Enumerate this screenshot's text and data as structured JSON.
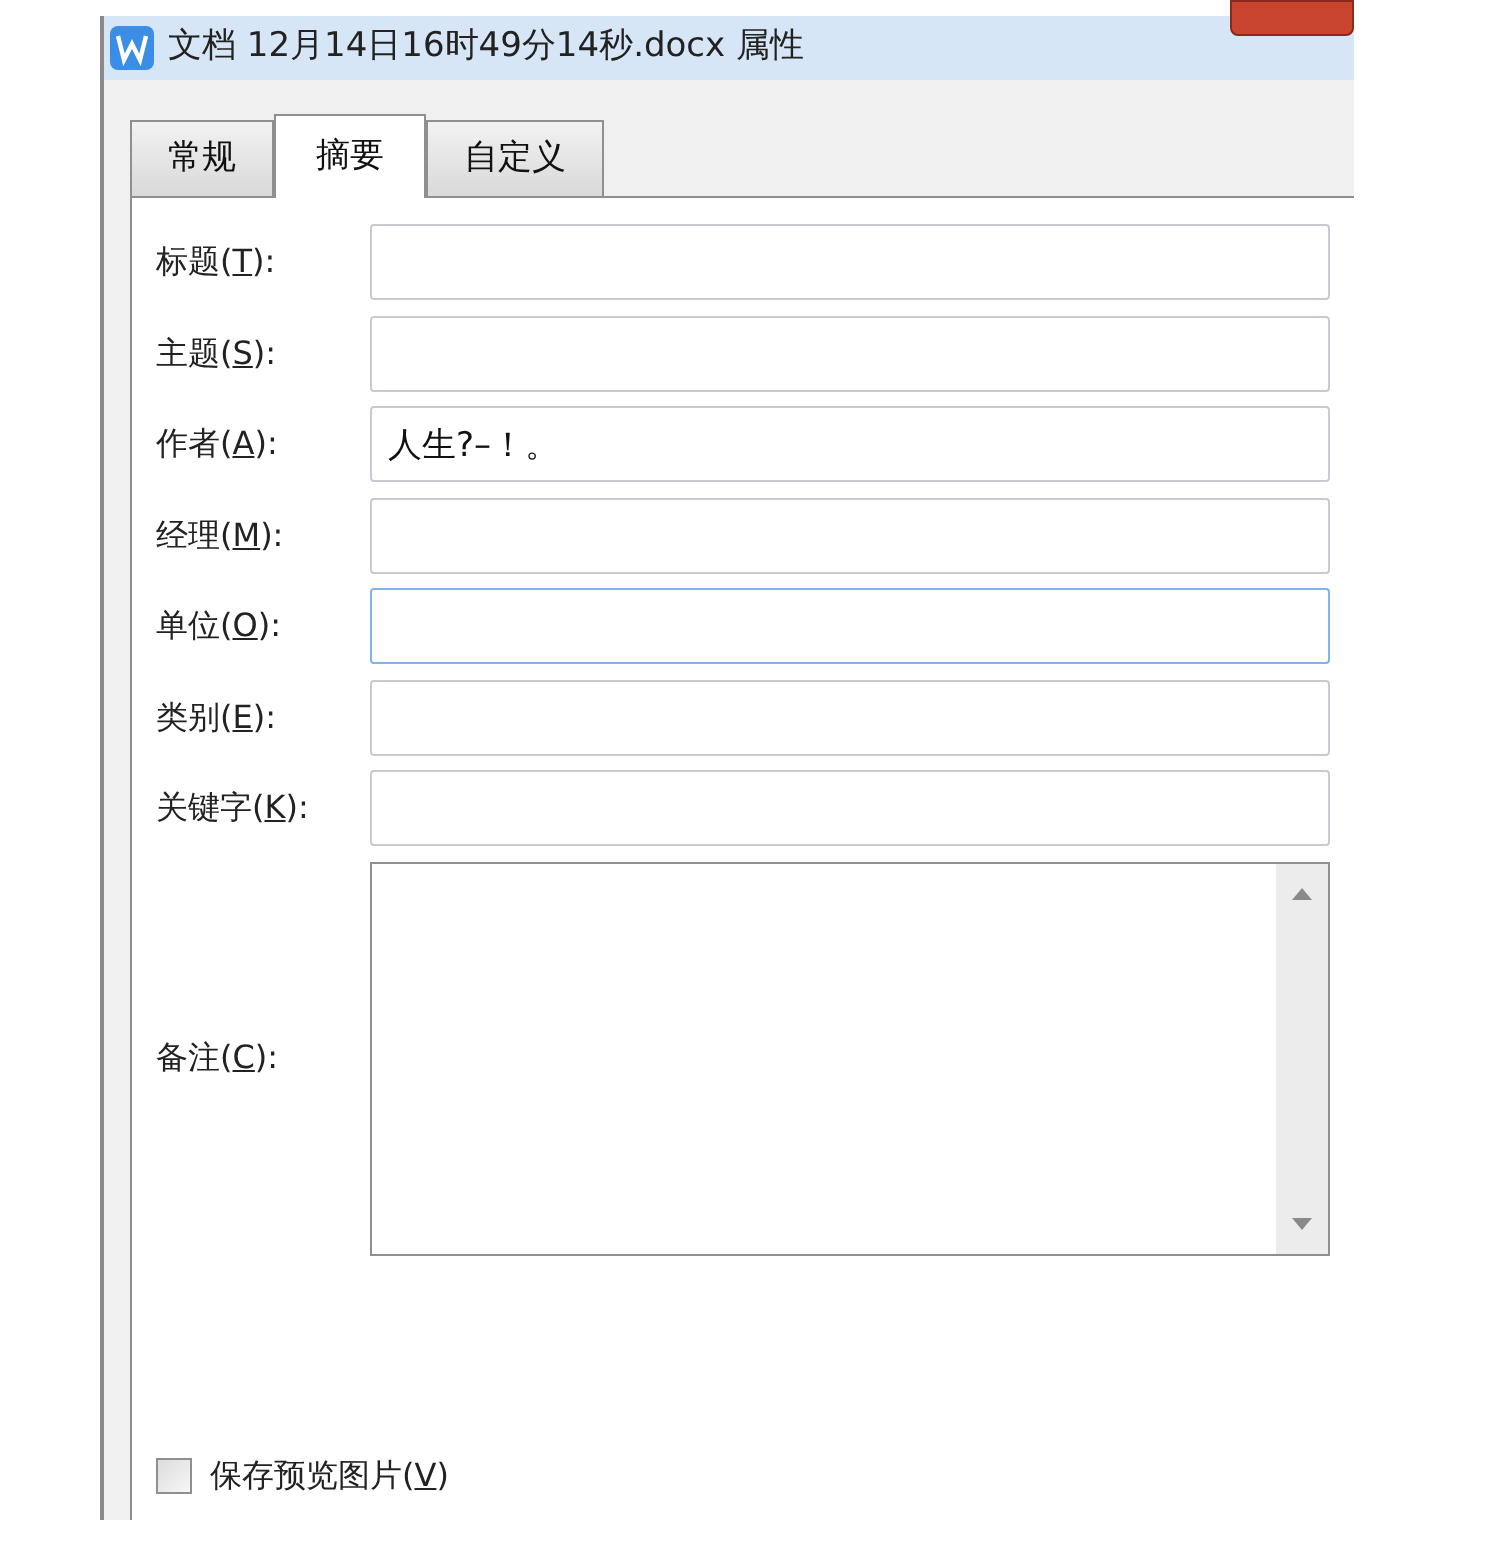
{
  "window": {
    "title": "文档 12月14日16时49分14秒.docx 属性"
  },
  "tabs": [
    {
      "label": "常规",
      "selected": false
    },
    {
      "label": "摘要",
      "selected": true
    },
    {
      "label": "自定义",
      "selected": false
    }
  ],
  "fields": [
    {
      "kind": "line",
      "label_before": "标题(",
      "access_key": "T",
      "label_after": "):",
      "focused": false
    },
    {
      "kind": "line",
      "label_before": "主题(",
      "access_key": "S",
      "label_after": "):",
      "focused": false
    },
    {
      "kind": "line",
      "label_before": "作者(",
      "access_key": "A",
      "label_after": "):",
      "value": "人生?–！。",
      "focused": false
    },
    {
      "kind": "line",
      "label_before": "经理(",
      "access_key": "M",
      "label_after": "):",
      "focused": false
    },
    {
      "kind": "line",
      "label_before": "单位(",
      "access_key": "O",
      "label_after": "):",
      "focused": true
    },
    {
      "kind": "line",
      "label_before": "类别(",
      "access_key": "E",
      "label_after": "):",
      "focused": false
    },
    {
      "kind": "line",
      "label_before": "关键字(",
      "access_key": "K",
      "label_after": "):",
      "focused": false
    },
    {
      "kind": "multiline",
      "label_before": "备注(",
      "access_key": "C",
      "label_after": "):",
      "focused": false
    }
  ],
  "save_preview": {
    "label_before": "保存预览图片(",
    "access_key": "V",
    "label_after": ")",
    "checked": false
  }
}
